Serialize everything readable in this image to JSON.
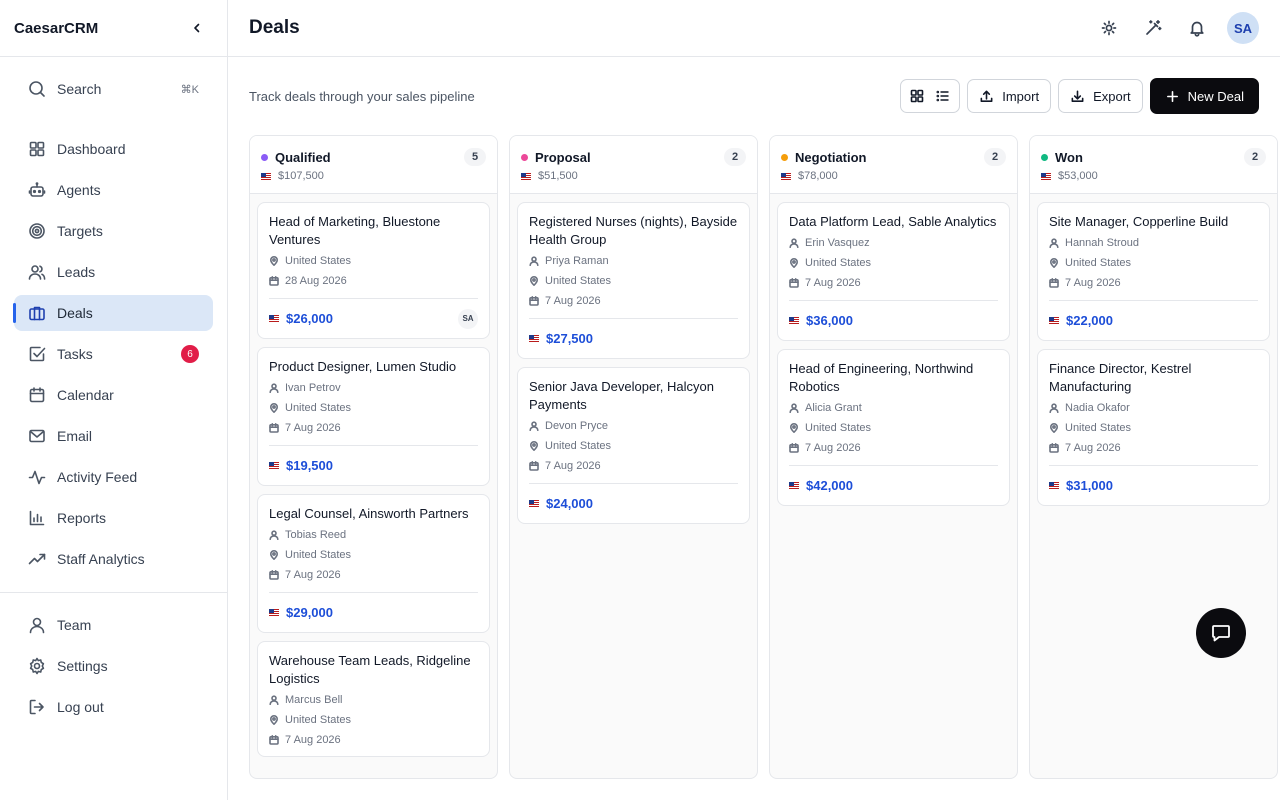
{
  "brand": "CaesarCRM",
  "sidebar": {
    "search": {
      "label": "Search",
      "shortcut": "⌘K"
    },
    "main_items": [
      {
        "id": "dashboard",
        "label": "Dashboard",
        "icon": "dashboard-icon"
      },
      {
        "id": "agents",
        "label": "Agents",
        "icon": "bot-icon"
      },
      {
        "id": "targets",
        "label": "Targets",
        "icon": "target-icon"
      },
      {
        "id": "leads",
        "label": "Leads",
        "icon": "users-icon"
      },
      {
        "id": "deals",
        "label": "Deals",
        "icon": "briefcase-icon",
        "active": true
      },
      {
        "id": "tasks",
        "label": "Tasks",
        "icon": "check-square-icon",
        "badge": "6"
      },
      {
        "id": "calendar",
        "label": "Calendar",
        "icon": "calendar-icon"
      },
      {
        "id": "email",
        "label": "Email",
        "icon": "mail-icon"
      },
      {
        "id": "activity-feed",
        "label": "Activity Feed",
        "icon": "activity-icon"
      },
      {
        "id": "reports",
        "label": "Reports",
        "icon": "bar-chart-icon"
      },
      {
        "id": "staff-analytics",
        "label": "Staff Analytics",
        "icon": "trending-up-icon"
      }
    ],
    "bottom_items": [
      {
        "id": "team",
        "label": "Team",
        "icon": "user-icon"
      },
      {
        "id": "settings",
        "label": "Settings",
        "icon": "gear-icon"
      },
      {
        "id": "log-out",
        "label": "Log out",
        "icon": "logout-icon"
      }
    ]
  },
  "header": {
    "title": "Deals",
    "avatar": "SA"
  },
  "toolbar": {
    "subtitle": "Track deals through your sales pipeline",
    "import_label": "Import",
    "export_label": "Export",
    "new_deal_label": "New Deal"
  },
  "colors": {
    "qualified": "#8b5cf6",
    "proposal": "#ec4899",
    "negotiation": "#f59e0b",
    "won": "#10b981",
    "accent": "#2563eb"
  },
  "columns": [
    {
      "id": "qualified",
      "title": "Qualified",
      "count": "5",
      "total": "$107,500",
      "cards": [
        {
          "title": "Head of Marketing, Bluestone Ventures",
          "contact": "",
          "location": "United States",
          "date": "28 Aug 2026",
          "amount": "$26,000",
          "owner": "SA"
        },
        {
          "title": "Product Designer, Lumen Studio",
          "contact": "Ivan Petrov",
          "location": "United States",
          "date": "7 Aug 2026",
          "amount": "$19,500",
          "owner": ""
        },
        {
          "title": "Legal Counsel, Ainsworth Partners",
          "contact": "Tobias Reed",
          "location": "United States",
          "date": "7 Aug 2026",
          "amount": "$29,000",
          "owner": ""
        },
        {
          "title": "Warehouse Team Leads, Ridgeline Logistics",
          "contact": "Marcus Bell",
          "location": "United States",
          "date": "7 Aug 2026",
          "amount": "",
          "owner": ""
        }
      ]
    },
    {
      "id": "proposal",
      "title": "Proposal",
      "count": "2",
      "total": "$51,500",
      "cards": [
        {
          "title": "Registered Nurses (nights), Bayside Health Group",
          "contact": "Priya Raman",
          "location": "United States",
          "date": "7 Aug 2026",
          "amount": "$27,500",
          "owner": ""
        },
        {
          "title": "Senior Java Developer, Halcyon Payments",
          "contact": "Devon Pryce",
          "location": "United States",
          "date": "7 Aug 2026",
          "amount": "$24,000",
          "owner": ""
        }
      ]
    },
    {
      "id": "negotiation",
      "title": "Negotiation",
      "count": "2",
      "total": "$78,000",
      "cards": [
        {
          "title": "Data Platform Lead, Sable Analytics",
          "contact": "Erin Vasquez",
          "location": "United States",
          "date": "7 Aug 2026",
          "amount": "$36,000",
          "owner": ""
        },
        {
          "title": "Head of Engineering, Northwind Robotics",
          "contact": "Alicia Grant",
          "location": "United States",
          "date": "7 Aug 2026",
          "amount": "$42,000",
          "owner": ""
        }
      ]
    },
    {
      "id": "won",
      "title": "Won",
      "count": "2",
      "total": "$53,000",
      "cards": [
        {
          "title": "Site Manager, Copperline Build",
          "contact": "Hannah Stroud",
          "location": "United States",
          "date": "7 Aug 2026",
          "amount": "$22,000",
          "owner": ""
        },
        {
          "title": "Finance Director, Kestrel Manufacturing",
          "contact": "Nadia Okafor",
          "location": "United States",
          "date": "7 Aug 2026",
          "amount": "$31,000",
          "owner": ""
        }
      ]
    }
  ]
}
